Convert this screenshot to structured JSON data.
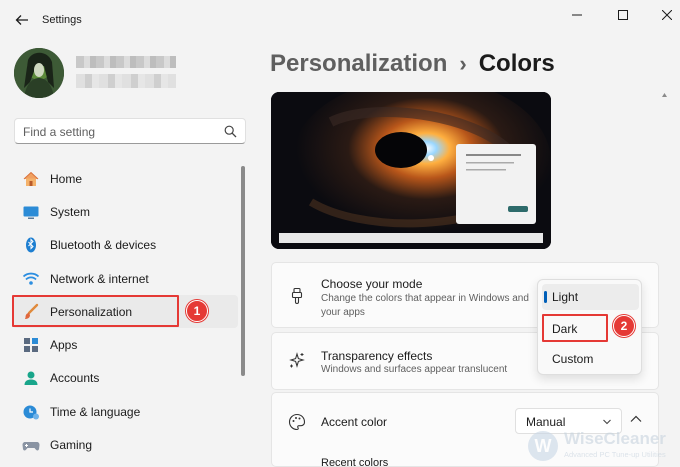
{
  "window": {
    "title": "Settings",
    "breadcrumb": {
      "parent": "Personalization",
      "separator": "›",
      "current": "Colors"
    }
  },
  "search": {
    "placeholder": "Find a setting"
  },
  "nav": {
    "items": [
      {
        "label": "Home",
        "icon": "home-icon"
      },
      {
        "label": "System",
        "icon": "system-icon"
      },
      {
        "label": "Bluetooth & devices",
        "icon": "bluetooth-icon"
      },
      {
        "label": "Network & internet",
        "icon": "network-icon"
      },
      {
        "label": "Personalization",
        "icon": "brush-icon",
        "active": true
      },
      {
        "label": "Apps",
        "icon": "apps-icon"
      },
      {
        "label": "Accounts",
        "icon": "accounts-icon"
      },
      {
        "label": "Time & language",
        "icon": "time-language-icon"
      },
      {
        "label": "Gaming",
        "icon": "gaming-icon"
      }
    ]
  },
  "settings": {
    "mode": {
      "title": "Choose your mode",
      "description": "Change the colors that appear in Windows and your apps"
    },
    "transparency": {
      "title": "Transparency effects",
      "description": "Windows and surfaces appear translucent"
    },
    "accent": {
      "title": "Accent color",
      "value": "Manual",
      "recent_label": "Recent colors"
    }
  },
  "mode_menu": {
    "options": [
      "Light",
      "Dark",
      "Custom"
    ],
    "selected": "Light"
  },
  "annotations": {
    "step1": "1",
    "step2": "2"
  },
  "watermark": {
    "title": "WiseCleaner",
    "subtitle": "Advanced PC Tune-up Utilities",
    "logo_letter": "W"
  },
  "colors": {
    "accent": "#005fb8",
    "annotation_red": "#e53935"
  }
}
